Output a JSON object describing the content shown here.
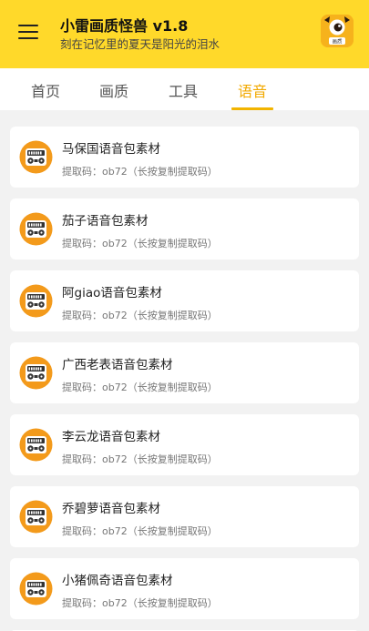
{
  "header": {
    "title": "小雷画质怪兽 v1.8",
    "subtitle": "刻在记忆里的夏天是阳光的泪水",
    "logo_caption": "画质"
  },
  "tabs": [
    {
      "label": "首页"
    },
    {
      "label": "画质"
    },
    {
      "label": "工具"
    },
    {
      "label": "语音",
      "active": true
    }
  ],
  "items": [
    {
      "title": "马保国语音包素材",
      "code": "提取码：ob72（长按复制提取码）"
    },
    {
      "title": "茄子语音包素材",
      "code": "提取码：ob72（长按复制提取码）"
    },
    {
      "title": "阿giao语音包素材",
      "code": "提取码：ob72（长按复制提取码）"
    },
    {
      "title": "广西老表语音包素材",
      "code": "提取码：ob72（长按复制提取码）"
    },
    {
      "title": "李云龙语音包素材",
      "code": "提取码：ob72（长按复制提取码）"
    },
    {
      "title": "乔碧萝语音包素材",
      "code": "提取码：ob72（长按复制提取码）"
    },
    {
      "title": "小猪佩奇语音包素材",
      "code": "提取码：ob72（长按复制提取码）"
    }
  ],
  "icons": {
    "menu": "hamburger-menu-icon",
    "logo": "monster-logo-icon",
    "item": "radio-cassette-icon"
  },
  "colors": {
    "header_bg": "#ffd92a",
    "accent": "#f2a900",
    "icon_orange": "#f39a1b",
    "background": "#f2f2f2"
  }
}
